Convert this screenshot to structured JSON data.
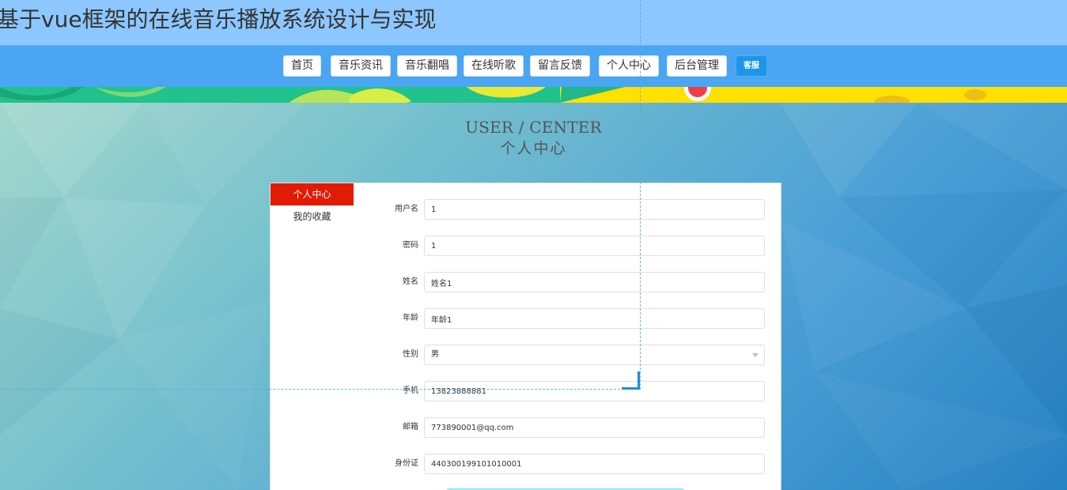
{
  "app": {
    "title": "基于vue框架的在线音乐播放系统设计与实现"
  },
  "navigation": {
    "items": [
      {
        "label": "首页"
      },
      {
        "label": "音乐资讯"
      },
      {
        "label": "音乐翻唱"
      },
      {
        "label": "在线听歌"
      },
      {
        "label": "留言反馈"
      },
      {
        "label": "个人中心"
      },
      {
        "label": "后台管理"
      }
    ],
    "service_label": "客服"
  },
  "page": {
    "heading_en": "USER / CENTER",
    "heading_cn": "个人中心"
  },
  "sidebar": {
    "items": [
      {
        "label": "个人中心",
        "active": true
      },
      {
        "label": "我的收藏",
        "active": false
      }
    ]
  },
  "profile_form": {
    "fields": [
      {
        "label": "用户名",
        "value": "1"
      },
      {
        "label": "密码",
        "value": "1"
      },
      {
        "label": "姓名",
        "value": "姓名1"
      },
      {
        "label": "年龄",
        "value": "年龄1"
      },
      {
        "label": "性别",
        "value": "男",
        "type": "select"
      },
      {
        "label": "手机",
        "value": "13823888881"
      },
      {
        "label": "邮箱",
        "value": "773890001@qq.com"
      },
      {
        "label": "身份证",
        "value": "440300199101010001"
      }
    ]
  },
  "colors": {
    "topbar": "#8cc7ff",
    "navbar": "#4aa6f3",
    "active_sidebar": "#e11b06",
    "service_button": "#1c96e8"
  }
}
